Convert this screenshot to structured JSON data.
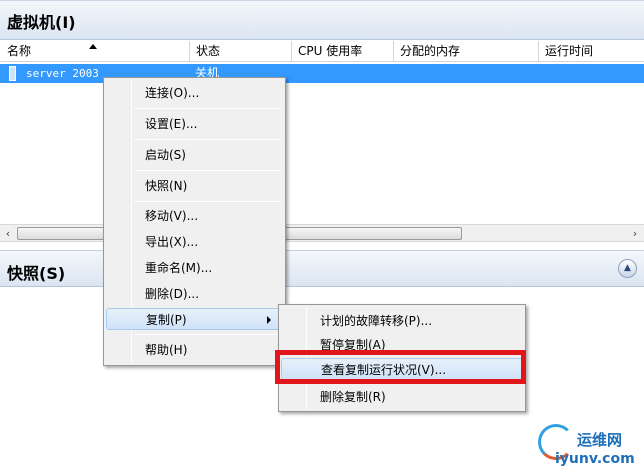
{
  "vm_pane": {
    "title": "虚拟机(I)",
    "columns": [
      "名称",
      "状态",
      "CPU 使用率",
      "分配的内存",
      "运行时间"
    ],
    "rows": [
      {
        "name": "server 2003",
        "state": "关机"
      }
    ]
  },
  "scrollbar": {
    "left_arrow": "‹",
    "right_arrow": "›"
  },
  "snapshot_pane": {
    "title": "快照(S)",
    "collapse_glyph": "▲"
  },
  "context_menu": {
    "items": [
      "连接(O)...",
      "设置(E)...",
      "启动(S)",
      "快照(N)",
      "移动(V)...",
      "导出(X)...",
      "重命名(M)...",
      "删除(D)...",
      "复制(P)",
      "帮助(H)"
    ],
    "highlighted": "复制(P)"
  },
  "submenu": {
    "items": [
      "计划的故障转移(P)...",
      "暂停复制(A)",
      "查看复制运行状况(V)...",
      "删除复制(R)"
    ],
    "highlighted": "查看复制运行状况(V)..."
  },
  "watermark": {
    "line1": "运维网",
    "line2": "iyunv.com"
  },
  "colors": {
    "selection": "#3399ff",
    "annotation_box": "#e0161b",
    "menu_bg": "#f0f0f0"
  }
}
